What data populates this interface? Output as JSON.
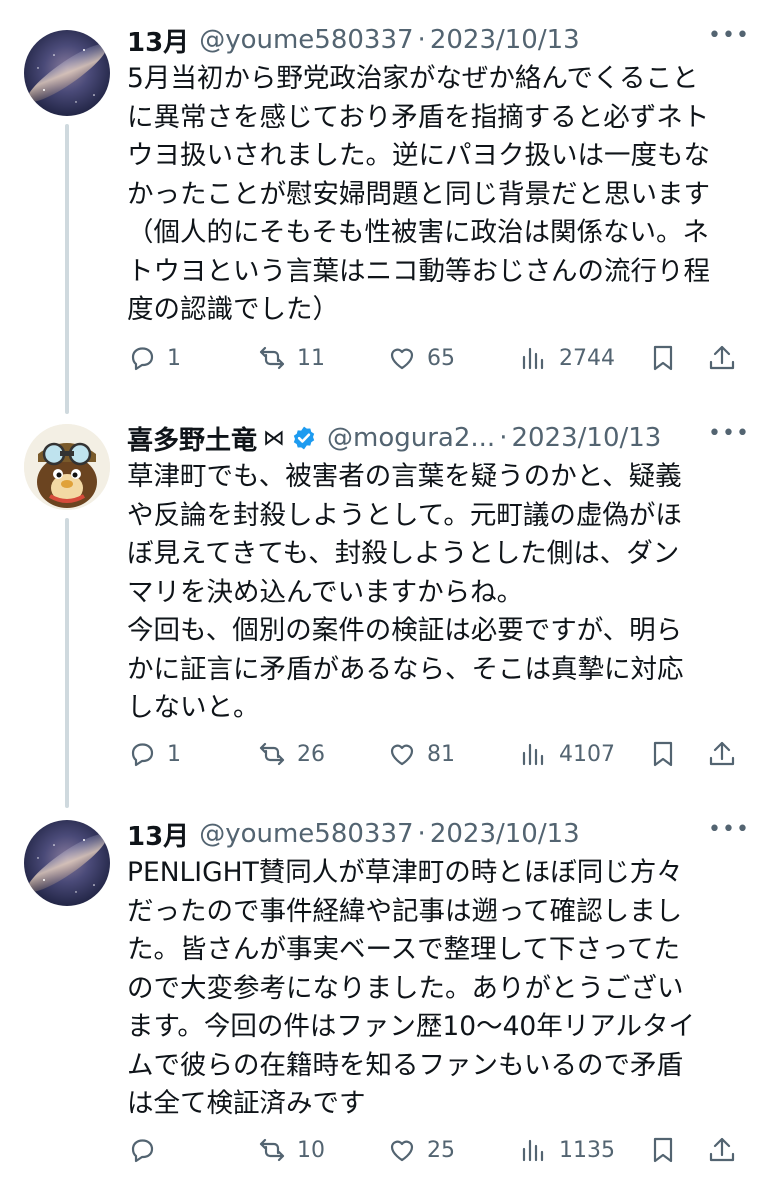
{
  "tweets": [
    {
      "name": "13月",
      "handle": "@youme580337",
      "dot": "·",
      "date": "2023/10/13",
      "more": "•••",
      "body": [
        "5月当初から野党政治家がなぜか絡んでくること",
        "に異常さを感じており矛盾を指摘すると必ずネト",
        "ウヨ扱いされました。逆にパヨク扱いは一度もな",
        "かったことが慰安婦問題と同じ背景だと思います",
        "（個人的にそもそも性被害に政治は関係ない。ネ",
        "トウヨという言葉はニコ動等おじさんの流行り程",
        "度の認識でした）"
      ],
      "replies": "1",
      "retweets": "11",
      "likes": "65",
      "views": "2744"
    },
    {
      "name": "喜多野土竜",
      "name_badge": "⋈",
      "handle": "@mogura2...",
      "dot": "·",
      "date": "2023/10/13",
      "more": "•••",
      "body": [
        "草津町でも、被害者の言葉を疑うのかと、疑義",
        "や反論を封殺しようとして。元町議の虚偽がほ",
        "ぼ見えてきても、封殺しようとした側は、ダン",
        "マリを決め込んでいますからね。",
        "今回も、個別の案件の検証は必要ですが、明ら",
        "かに証言に矛盾があるなら、そこは真摯に対応",
        "しないと。"
      ],
      "replies": "1",
      "retweets": "26",
      "likes": "81",
      "views": "4107"
    },
    {
      "name": "13月",
      "handle": "@youme580337",
      "dot": "·",
      "date": "2023/10/13",
      "more": "•••",
      "body": [
        "PENLIGHT賛同人が草津町の時とほぼ同じ方々",
        "だったので事件経緯や記事は遡って確認しまし",
        "た。皆さんが事実ベースで整理して下さってた",
        "ので大変参考になりました。ありがとうござい",
        "ます。今回の件はファン歴10〜40年リアルタイ",
        "ムで彼らの在籍時を知るファンもいるので矛盾",
        "は全て検証済みです"
      ],
      "replies": "",
      "retweets": "10",
      "likes": "25",
      "views": "1135"
    }
  ],
  "icons": {
    "reply": "reply-icon",
    "retweet": "retweet-icon",
    "like": "heart-icon",
    "views": "views-icon",
    "bookmark": "bookmark-icon",
    "share": "share-icon",
    "verified": "verified-badge-icon"
  },
  "colors": {
    "text": "#0f1419",
    "secondary": "#536471",
    "thread_line": "#cfd9de",
    "verified": "#1d9bf0"
  }
}
